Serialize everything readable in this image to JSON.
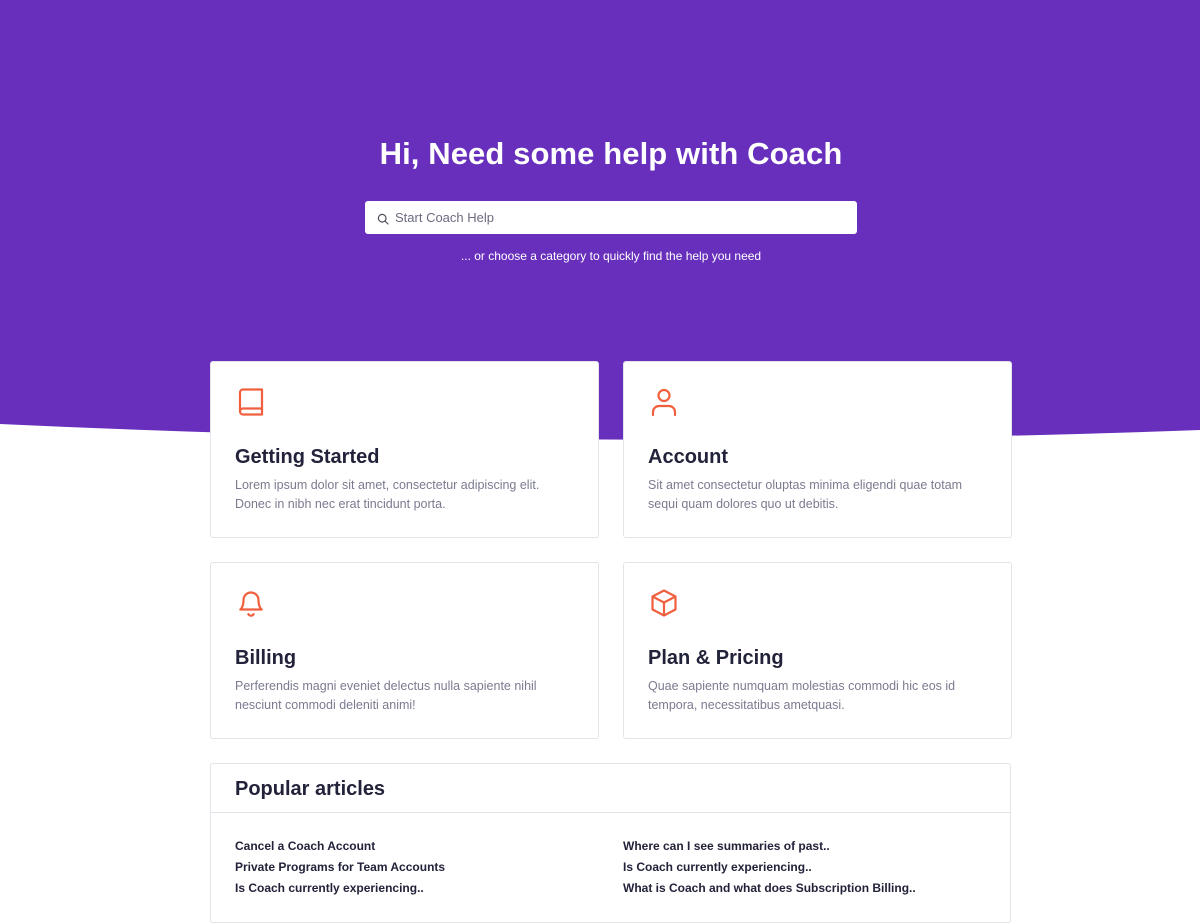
{
  "colors": {
    "hero_bg": "#672FBC",
    "accent": "#F1603E",
    "text_dark": "#22223A",
    "text_muted": "#7B7B90",
    "card_border": "#E3E3EA"
  },
  "hero": {
    "title": "Hi, Need some help with Coach",
    "search": {
      "placeholder": "Start Coach Help",
      "value": "",
      "icon": "search-icon"
    },
    "subtitle": "... or choose a category to quickly find the help you need"
  },
  "categories": [
    {
      "title": "Getting Started",
      "description": "Lorem ipsum dolor sit amet, consectetur adipiscing elit. Donec in nibh nec erat tincidunt porta.",
      "icon": "book-icon"
    },
    {
      "title": "Account",
      "description": "Sit amet consectetur oluptas minima eligendi quae totam sequi quam dolores quo ut debitis.",
      "icon": "user-icon"
    },
    {
      "title": "Billing",
      "description": "Perferendis magni eveniet delectus nulla sapiente nihil nesciunt commodi deleniti animi!",
      "icon": "bell-icon"
    },
    {
      "title": "Plan & Pricing",
      "description": "Quae sapiente numquam molestias commodi hic eos id tempora, necessitatibus ametquasi.",
      "icon": "box-icon"
    }
  ],
  "popular": {
    "title": "Popular articles",
    "left": [
      "Cancel a Coach Account",
      "Private Programs for Team Accounts",
      "Is Coach currently experiencing.."
    ],
    "right": [
      "Where can I see summaries of past..",
      "Is Coach currently experiencing..",
      "What is Coach and what does Subscription Billing.."
    ]
  }
}
